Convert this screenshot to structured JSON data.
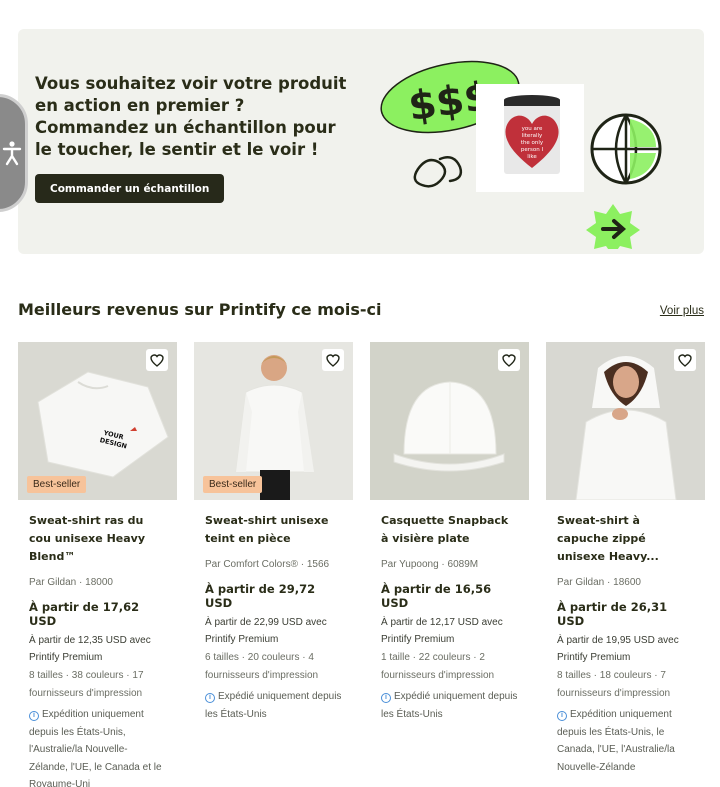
{
  "banner": {
    "headline": "Vous souhaitez voir votre produit en action en premier ? Commandez un échantillon pour le toucher, le sentir et le voir !",
    "cta_label": "Commander un échantillon",
    "art_money_text": "$$$",
    "mug_text": "you are literally the only person I like",
    "colors": {
      "background": "#f1f2ed",
      "cta": "#27291a",
      "lime": "#8cf060",
      "heart": "#c0303a"
    }
  },
  "section": {
    "title": "Meilleurs revenus sur Printify ce mois-ci",
    "see_more": "Voir plus"
  },
  "products": [
    {
      "name": "Sweat-shirt ras du cou unisexe Heavy Blend™",
      "brand_line": "Par Gildan · 18000",
      "badge": "Best-seller",
      "price": "À partir de 17,62 USD",
      "premium": "À partir de 12,35 USD avec Printify Premium",
      "meta": "8 tailles · 38 couleurs · 17 fournisseurs d'impression",
      "shipping": "Expédition uniquement depuis les États-Unis, l'Australie/la Nouvelle-Zélande, l'UE, le Canada et le Royaume-Uni",
      "image_text": "YOUR DESIGN"
    },
    {
      "name": "Sweat-shirt unisexe teint en pièce",
      "brand_line": "Par Comfort Colors® · 1566",
      "badge": "Best-seller",
      "price": "À partir de 29,72 USD",
      "premium": "À partir de 22,99 USD avec Printify Premium",
      "meta": "6 tailles · 20 couleurs · 4 fournisseurs d'impression",
      "shipping": "Expédié uniquement depuis les États-Unis"
    },
    {
      "name": "Casquette Snapback à visière plate",
      "brand_line": "Par Yupoong · 6089M",
      "badge": "",
      "price": "À partir de 16,56 USD",
      "premium": "À partir de 12,17 USD avec Printify Premium",
      "meta": "1 taille · 22 couleurs · 2 fournisseurs d'impression",
      "shipping": "Expédié uniquement depuis les États-Unis"
    },
    {
      "name": "Sweat-shirt à capuche zippé unisexe Heavy...",
      "brand_line": "Par Gildan · 18600",
      "badge": "",
      "price": "À partir de 26,31 USD",
      "premium": "À partir de 19,95 USD avec Printify Premium",
      "meta": "8 tailles · 18 couleurs · 7 fournisseurs d'impression",
      "shipping": "Expédition uniquement depuis les États-Unis, le Canada, l'UE, l'Australie/la Nouvelle-Zélande"
    }
  ],
  "icons": {
    "accessibility": "accessibility-icon",
    "favorite": "heart-outline-icon",
    "info": "info-icon"
  }
}
